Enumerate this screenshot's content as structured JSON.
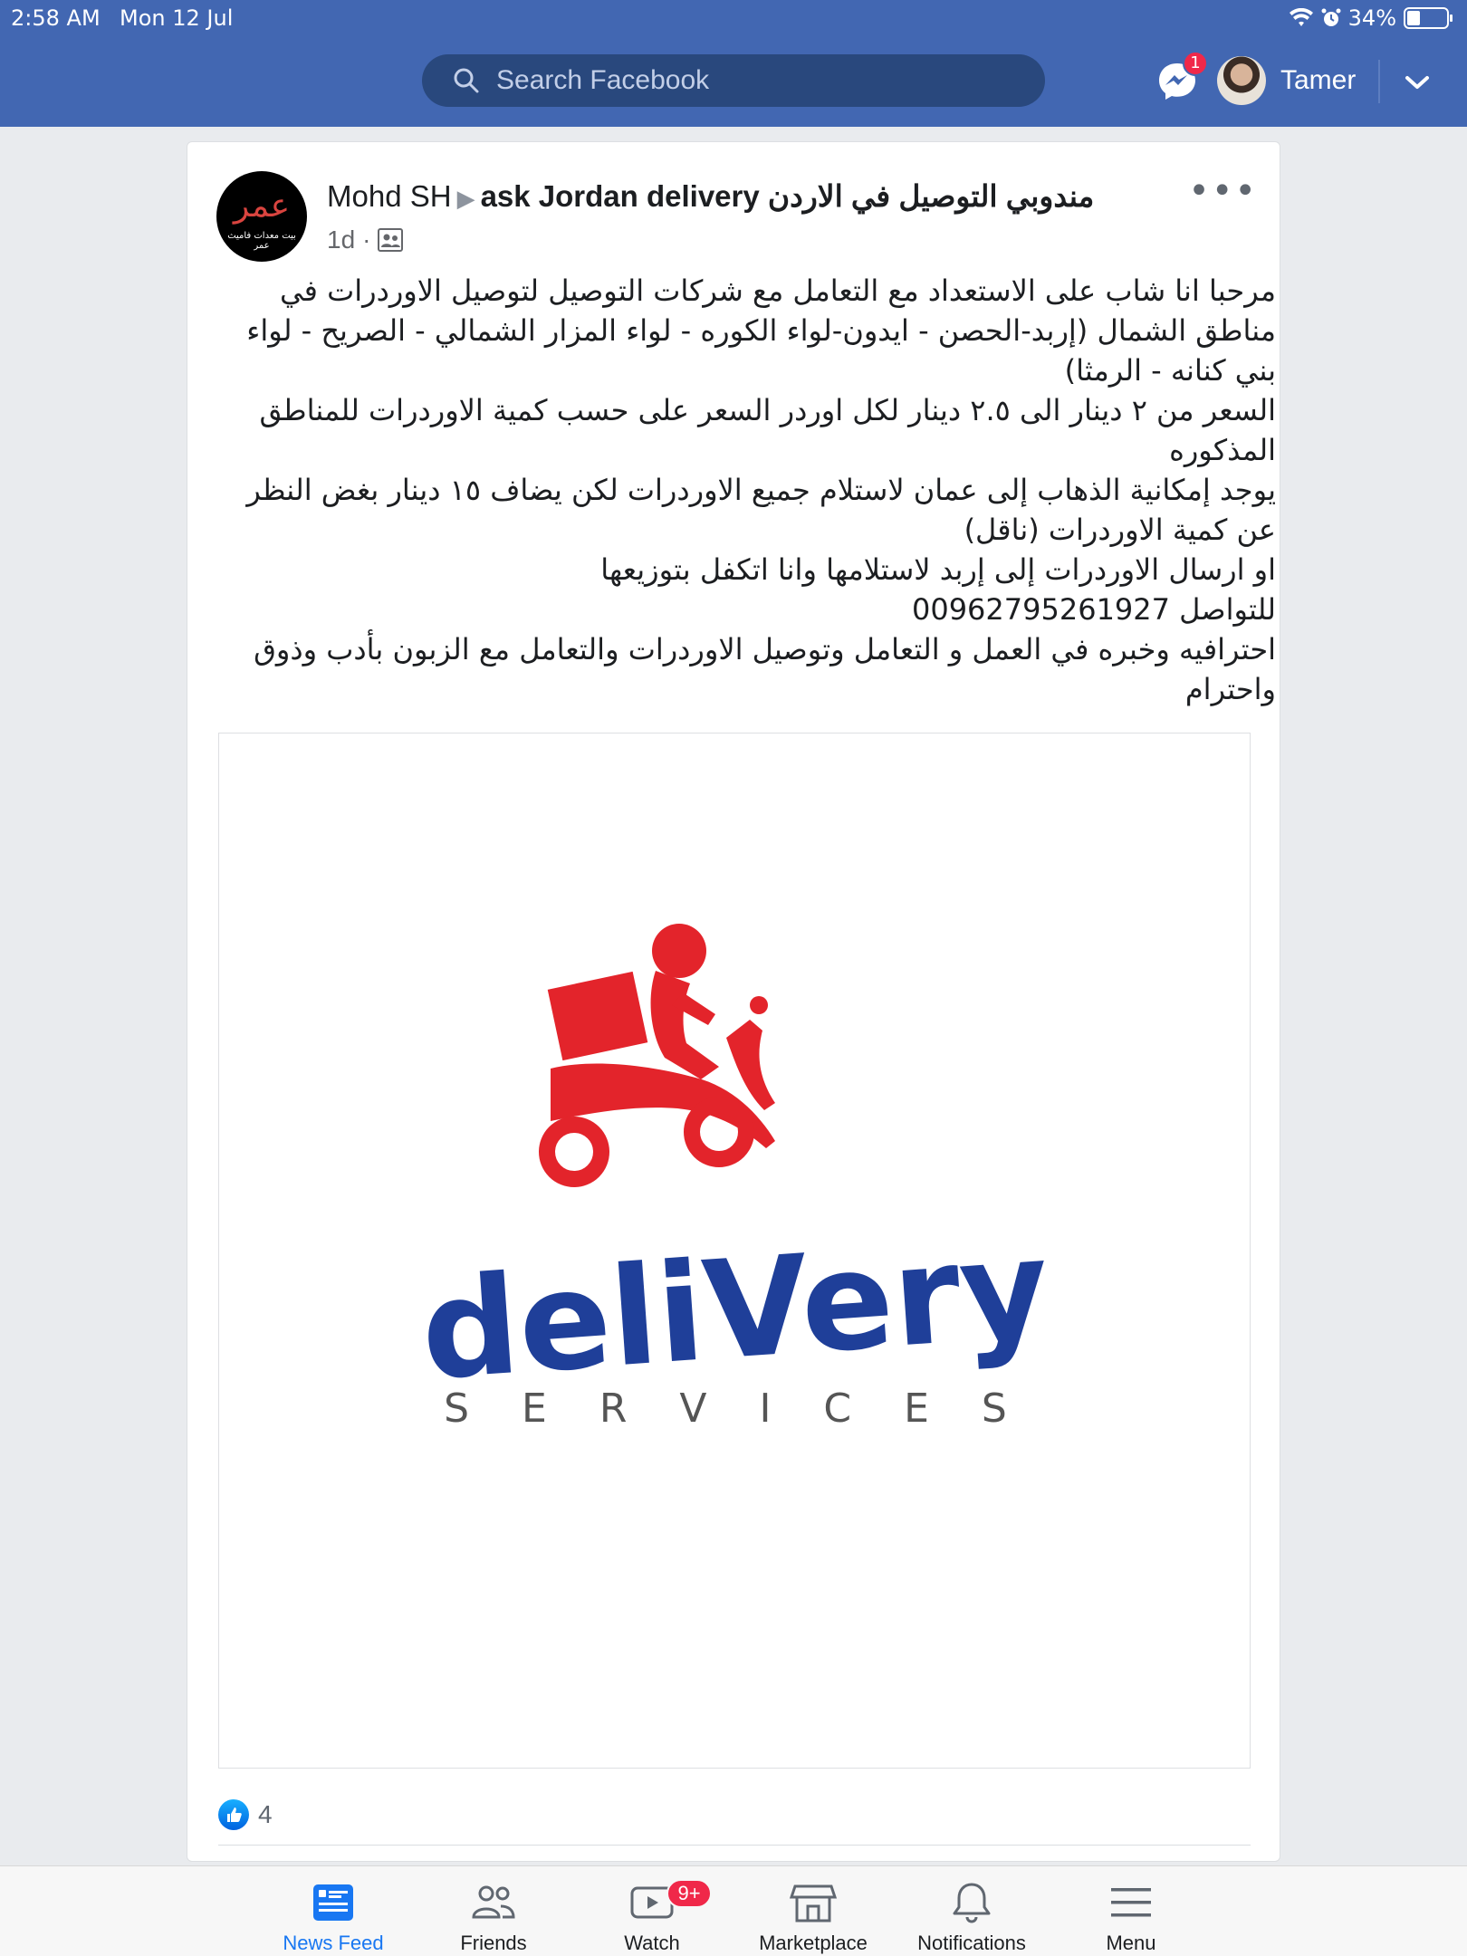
{
  "status_bar": {
    "time": "2:58 AM",
    "date": "Mon 12 Jul",
    "battery_percent": "34%",
    "battery_level": 0.34
  },
  "header": {
    "search_placeholder": "Search Facebook",
    "messenger_badge": "1",
    "user_name": "Tamer"
  },
  "post": {
    "author": "Mohd SH",
    "group": "ask Jordan delivery مندوبي التوصيل في الاردن",
    "time": "1d",
    "separator": "·",
    "more": "•••",
    "avatar_text": "عمر",
    "avatar_subtext": "بيت معدات فاميث عمر",
    "text_lines": [
      "مرحبا انا شاب على الاستعداد مع التعامل مع شركات التوصيل لتوصيل الاوردرات في مناطق الشمال (إربد-الحصن - ايدون-لواء الكوره - لواء المزار الشمالي - الصريح - لواء بني كنانه - الرمثا)",
      "السعر من ٢ دينار الى ٢.٥ دينار لكل اوردر السعر على حسب كمية الاوردرات للمناطق المذكوره",
      "يوجد إمكانية الذهاب إلى عمان لاستلام جميع الاوردرات لكن يضاف ١٥ دينار بغض النظر عن كمية الاوردرات (ناقل)",
      "او ارسال الاوردرات إلى إربد لاستلامها وانا اتكفل بتوزيعها",
      "للتواصل 00962795261927",
      "احترافيه وخبره في العمل و التعامل وتوصيل الاوردرات والتعامل مع الزبون بأدب وذوق واحترام"
    ],
    "image": {
      "logo_word": "deliVery",
      "logo_sub": "S E R V I C E S",
      "logo_color": "#1f3f99",
      "icon_color": "#e3242b"
    },
    "reaction_count": "4"
  },
  "tabs": [
    {
      "label": "News Feed",
      "icon": "news-feed-icon",
      "active": true
    },
    {
      "label": "Friends",
      "icon": "friends-icon",
      "active": false
    },
    {
      "label": "Watch",
      "icon": "watch-icon",
      "active": false,
      "badge": "9+"
    },
    {
      "label": "Marketplace",
      "icon": "marketplace-icon",
      "active": false
    },
    {
      "label": "Notifications",
      "icon": "bell-icon",
      "active": false
    },
    {
      "label": "Menu",
      "icon": "menu-icon",
      "active": false
    }
  ],
  "colors": {
    "brand_blue": "#4267b2",
    "search_bg": "#29487d",
    "badge_red": "#f02849",
    "active_tab": "#1877f2"
  }
}
